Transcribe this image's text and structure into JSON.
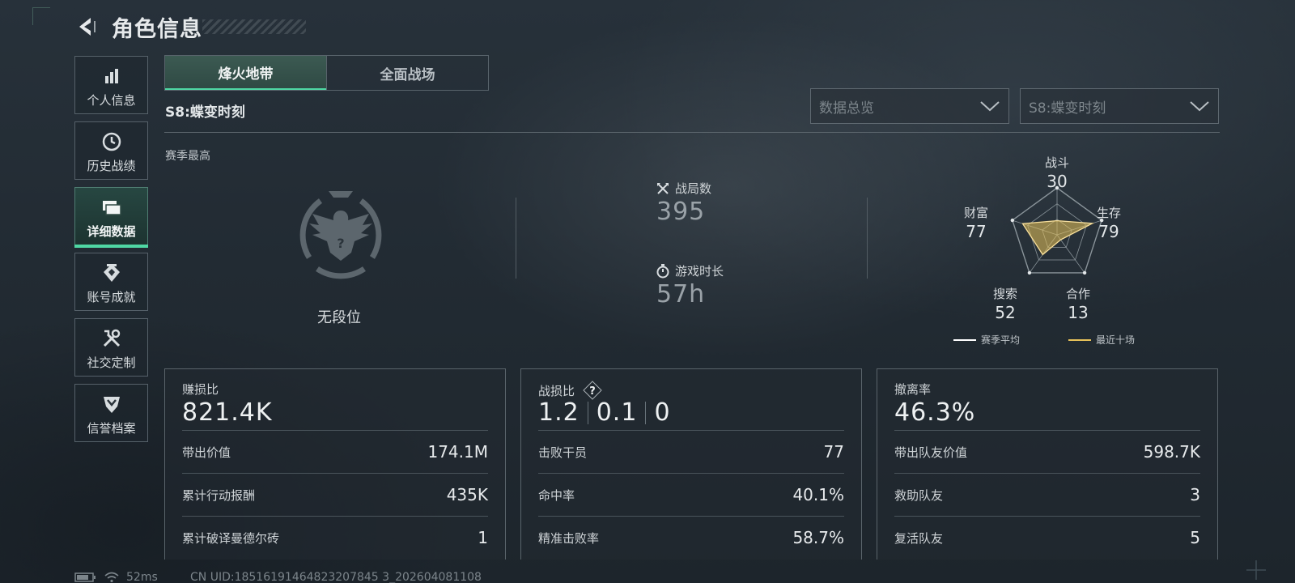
{
  "header": {
    "title": "角色信息"
  },
  "sidebar": {
    "items": [
      {
        "label": "个人信息",
        "icon": "bar-chart-icon"
      },
      {
        "label": "历史战绩",
        "icon": "history-clock-icon"
      },
      {
        "label": "详细数据",
        "icon": "folder-icon",
        "active": true
      },
      {
        "label": "账号成就",
        "icon": "achievement-medal-icon"
      },
      {
        "label": "社交定制",
        "icon": "tools-icon"
      },
      {
        "label": "信誉档案",
        "icon": "shield-rank-icon"
      }
    ]
  },
  "tabs": [
    {
      "label": "烽火地带",
      "active": true
    },
    {
      "label": "全面战场",
      "active": false
    }
  ],
  "season": {
    "name": "S8:蝶变时刻"
  },
  "filters": {
    "view": "数据总览",
    "season": "S8:蝶变时刻"
  },
  "overview": {
    "section_label": "赛季最高",
    "rank": "无段位",
    "matches_label": "战局数",
    "matches_value": "395",
    "playtime_label": "游戏时长",
    "playtime_value": "57h"
  },
  "radar": {
    "axes": [
      {
        "label": "战斗",
        "value": "30"
      },
      {
        "label": "生存",
        "value": "79"
      },
      {
        "label": "合作",
        "value": "13"
      },
      {
        "label": "搜索",
        "value": "52"
      },
      {
        "label": "财富",
        "value": "77"
      }
    ],
    "legend": {
      "season_avg": "赛季平均",
      "recent_ten": "最近十场"
    },
    "colors": {
      "season_avg": "#ffffff",
      "recent_ten": "#e8c25a"
    }
  },
  "cards": [
    {
      "title": "赚损比",
      "big": "821.4K",
      "rows": [
        {
          "k": "带出价值",
          "v": "174.1M"
        },
        {
          "k": "累计行动报酬",
          "v": "435K"
        },
        {
          "k": "累计破译曼德尔砖",
          "v": "1"
        }
      ]
    },
    {
      "title": "战损比",
      "help": "?",
      "big_parts": [
        "1.2",
        "0.1",
        "0"
      ],
      "rows": [
        {
          "k": "击败干员",
          "v": "77"
        },
        {
          "k": "命中率",
          "v": "40.1%"
        },
        {
          "k": "精准击败率",
          "v": "58.7%"
        }
      ]
    },
    {
      "title": "撤离率",
      "big": "46.3%",
      "rows": [
        {
          "k": "带出队友价值",
          "v": "598.7K"
        },
        {
          "k": "救助队友",
          "v": "3"
        },
        {
          "k": "复活队友",
          "v": "5"
        }
      ]
    }
  ],
  "footer": {
    "ping": "52ms",
    "uid": "CN UID:18516191464823207845 3_202604081108"
  },
  "accent": "#4fd8a4"
}
